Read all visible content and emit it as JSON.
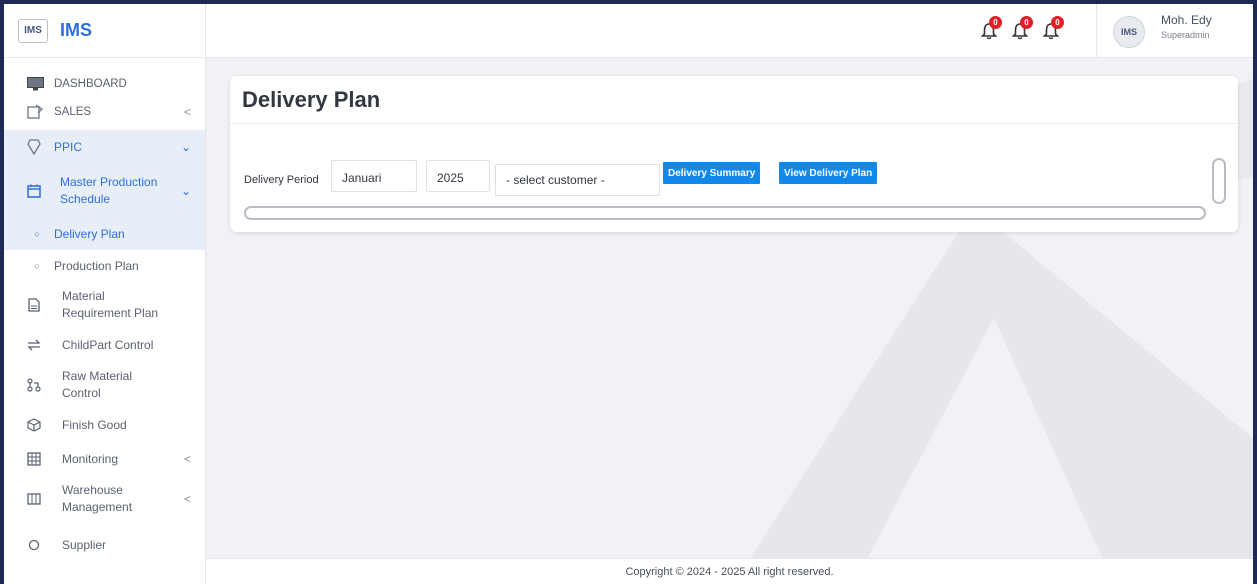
{
  "brand": {
    "logo_text": "IMS",
    "name": "IMS"
  },
  "sidebar": {
    "items": [
      {
        "label": "DASHBOARD"
      },
      {
        "label": "SALES",
        "chevron": "<"
      },
      {
        "label": "PPIC",
        "chevron": "⌄"
      },
      {
        "label": "Master Production Schedule",
        "chevron": "⌄"
      },
      {
        "label": "Delivery Plan",
        "bullet": "○"
      },
      {
        "label": "Production Plan",
        "bullet": "○"
      },
      {
        "label": "Material Requirement Plan"
      },
      {
        "label": "ChildPart Control"
      },
      {
        "label": "Raw Material Control"
      },
      {
        "label": "Finish Good"
      },
      {
        "label": "Monitoring",
        "chevron": "<"
      },
      {
        "label": "Warehouse Management",
        "chevron": "<"
      },
      {
        "label": "Supplier"
      }
    ]
  },
  "header": {
    "notifications": [
      {
        "count": "0"
      },
      {
        "count": "0"
      },
      {
        "count": "0"
      }
    ],
    "avatar_text": "IMS",
    "user_name": "Moh. Edy",
    "user_role": "Superadmin"
  },
  "main": {
    "title": "Delivery Plan",
    "filter": {
      "label": "Delivery Period",
      "period_value": "Januari",
      "year_value": "2025",
      "customer_placeholder": "- select customer -"
    },
    "buttons": {
      "summary": "Delivery Summary",
      "view": "View Delivery Plan"
    }
  },
  "footer": {
    "text": "Copyright © 2024 - 2025 All right reserved."
  },
  "colors": {
    "accent": "#2f6fdc",
    "button": "#1089ea",
    "badge": "#e01f26",
    "frame": "#1e2a55"
  },
  "icons": {
    "dashboard": "monitor-icon",
    "sales": "sales-icon",
    "ppic": "ppic-icon",
    "mps": "calendar-icon",
    "mrp": "document-icon",
    "childpart": "swap-icon",
    "raw": "branch-icon",
    "finish": "box-icon",
    "monitoring": "grid-icon",
    "warehouse": "warehouse-icon",
    "supplier": "circle-icon",
    "bell": "bell-icon"
  }
}
